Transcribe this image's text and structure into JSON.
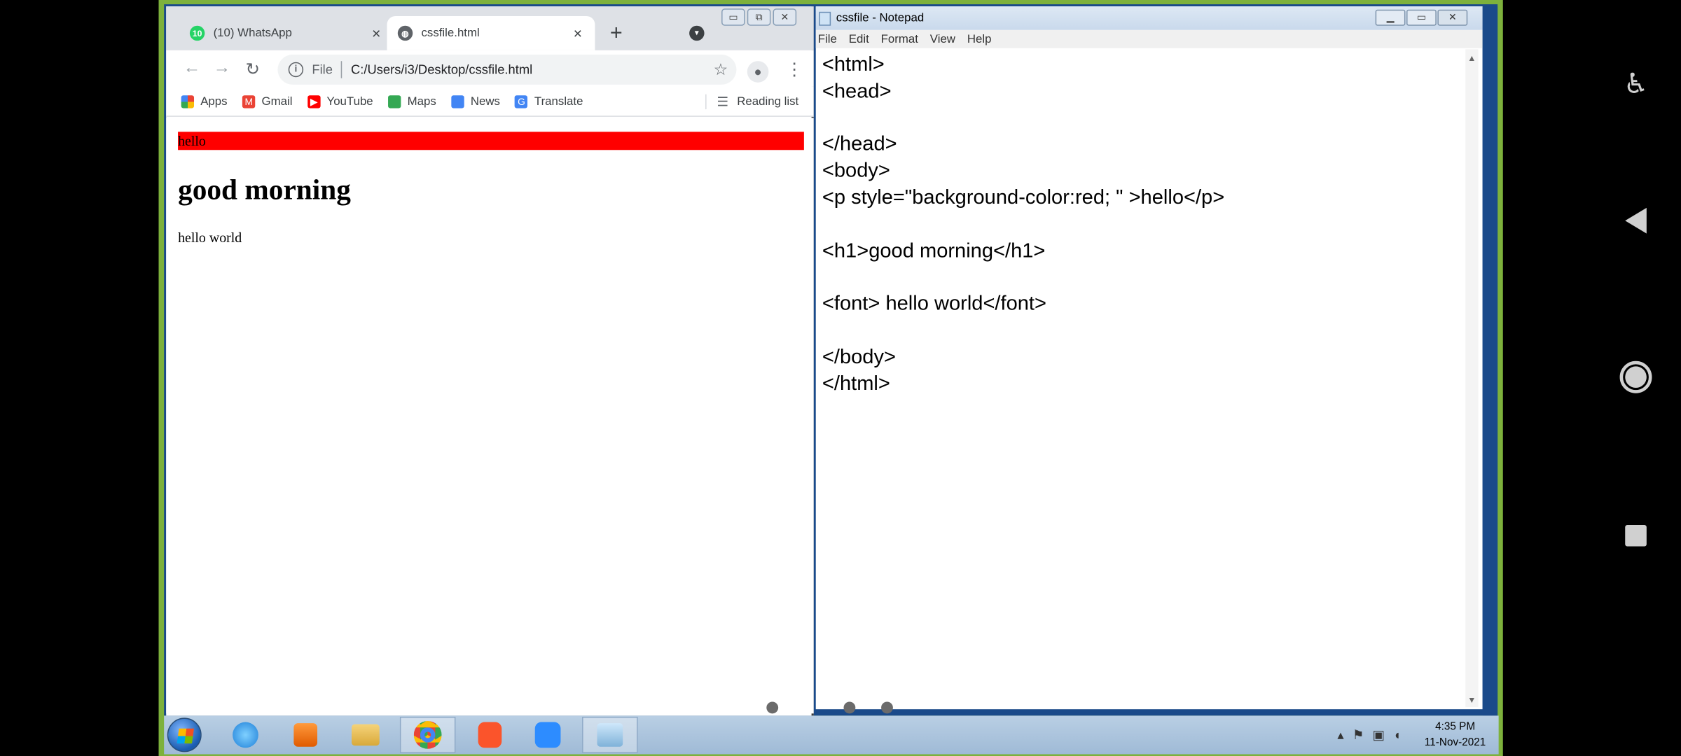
{
  "browser": {
    "tabs": [
      {
        "label": "(10) WhatsApp",
        "badge": "10",
        "active": false,
        "close": "×"
      },
      {
        "label": "cssfile.html",
        "active": true,
        "close": "×"
      }
    ],
    "new_tab": "+",
    "address": {
      "scheme": "File",
      "path": "C:/Users/i3/Desktop/cssfile.html"
    },
    "bookmarks": [
      {
        "label": "Apps",
        "icon": "apps-grid-icon"
      },
      {
        "label": "Gmail",
        "icon": "gmail-icon"
      },
      {
        "label": "YouTube",
        "icon": "youtube-icon"
      },
      {
        "label": "Maps",
        "icon": "maps-icon"
      },
      {
        "label": "News",
        "icon": "news-icon"
      },
      {
        "label": "Translate",
        "icon": "translate-icon"
      }
    ],
    "reading_list": "Reading list",
    "page": {
      "paragraph": "hello",
      "paragraph_bg": "#ff0000",
      "heading": "good morning",
      "font_text": "hello world"
    }
  },
  "notepad": {
    "title": "cssfile - Notepad",
    "menu": [
      "File",
      "Edit",
      "Format",
      "View",
      "Help"
    ],
    "content": "<html>\n<head>\n\n</head>\n<body>\n<p style=\"background-color:red; \" >hello</p>\n\n<h1>good morning</h1>\n\n<font> hello world</font>\n\n</body>\n</html>"
  },
  "taskbar": {
    "apps": [
      "start-orb",
      "internet-explorer",
      "media-player",
      "file-explorer",
      "chrome",
      "brave",
      "zoom",
      "notepad"
    ],
    "clock_time": "4:35 PM",
    "clock_date": "11-Nov-2021"
  },
  "colors": {
    "desktop_border": "#7db13c",
    "taskbar": "#b9cfe4",
    "chrome_tabstrip": "#dee1e6"
  }
}
